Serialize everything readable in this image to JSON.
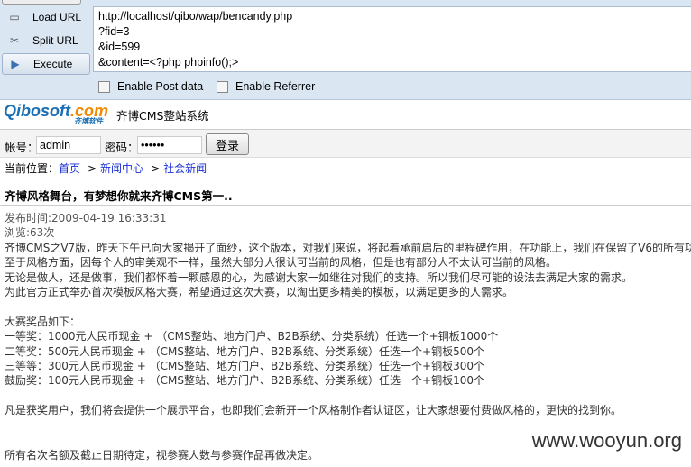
{
  "toolbar": {
    "load": "Load URL",
    "split": "Split URL",
    "execute": "Execute",
    "url_lines": "http://localhost/qibo/wap/bencandy.php\n?fid=3\n&id=599\n&content=<?php phpinfo();>",
    "post": "Enable Post data",
    "referrer": "Enable Referrer"
  },
  "site": {
    "logo": "Qibosoft",
    "logo_com": ".com",
    "logo_sub": "齐博软件",
    "name": "齐博CMS整站系统"
  },
  "login": {
    "user_label": "帐号：",
    "user_value": "admin",
    "pass_label": "密码：",
    "pass_value": "••••••",
    "submit": "登录"
  },
  "breadcrumb": {
    "label": "当前位置：",
    "home": "首页",
    "sep": " -> ",
    "news": "新闻中心",
    "social": "社会新闻"
  },
  "article": {
    "title": "齐博风格舞台，有梦想你就来齐博CMS第一..",
    "date": "发布时间:2009-04-19 16:33:31",
    "views": "浏览:63次",
    "lines": [
      "齐博CMS之V7版，昨天下午已向大家揭开了面纱，这个版本，对我们来说，将起着承前启后的里程碑作用，在功能上，我们在保留了V6的所有功",
      "至于风格方面，因每个人的审美观不一样，虽然大部分人很认可当前的风格，但是也有部分人不太认可当前的风格。",
      "无论是做人，还是做事，我们都怀着一颗感恩的心，为感谢大家一如继往对我们的支持。所以我们尽可能的设法去满足大家的需求。",
      "为此官方正式举办首次模板风格大赛，希望通过这次大赛，以淘出更多精美的模板，以满足更多的人需求。",
      "",
      "大赛奖品如下：",
      "一等奖：1000元人民币现金 + （CMS整站、地方门户、B2B系统、分类系统）任选一个+铜板1000个",
      "二等奖：500元人民币现金 + （CMS整站、地方门户、B2B系统、分类系统）任选一个+铜板500个",
      "三等等：300元人民币现金 + （CMS整站、地方门户、B2B系统、分类系统）任选一个+铜板300个",
      "鼓励奖：100元人民币现金 + （CMS整站、地方门户、B2B系统、分类系统）任选一个+铜板100个",
      "",
      "凡是获奖用户，我们将会提供一个展示平台，也即我们会新开一个风格制作者认证区，让大家想要付费做风格的，更快的找到你。",
      "",
      "",
      "所有名次名额及截止日期待定，视参赛人数与参赛作品再做决定。"
    ]
  },
  "watermark": "www.wooyun.org"
}
